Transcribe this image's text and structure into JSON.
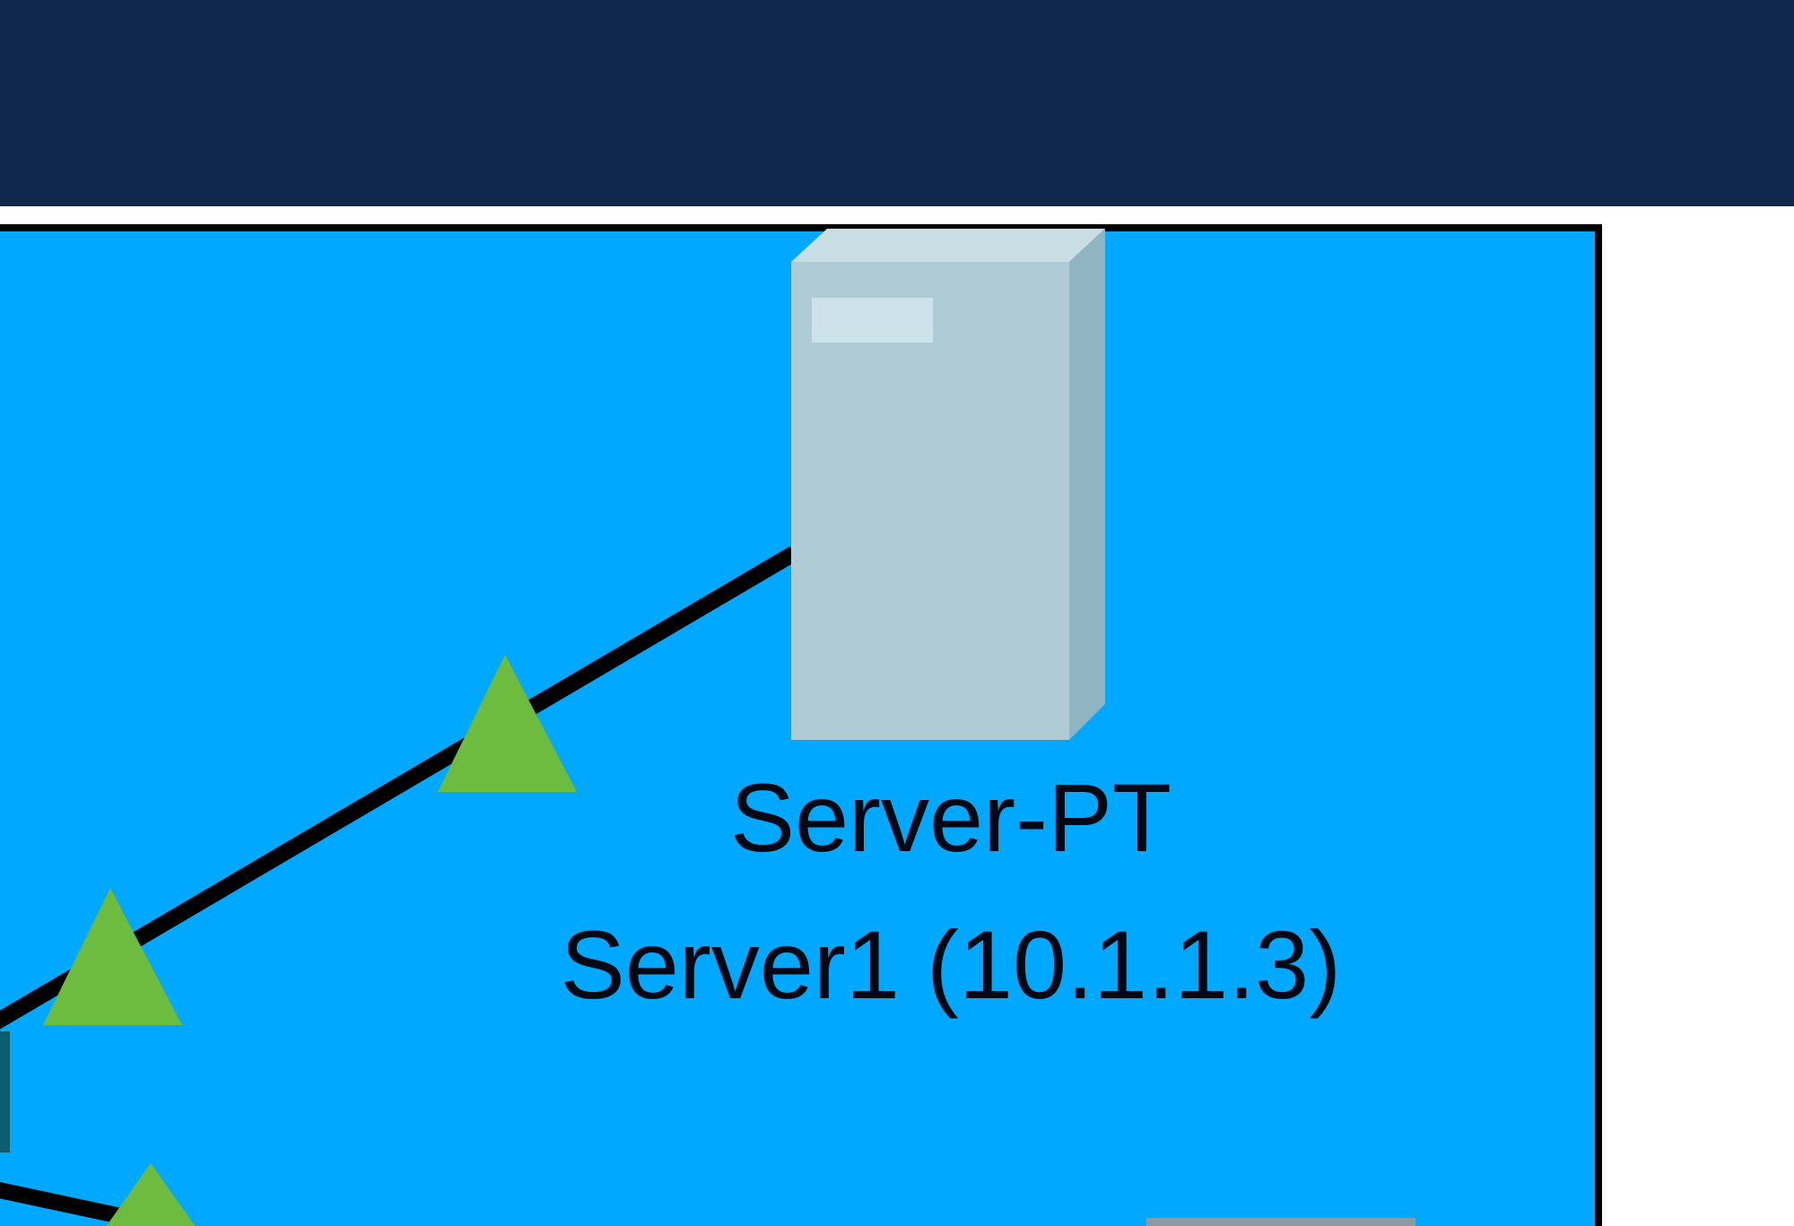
{
  "colors": {
    "topbar": "#10264b",
    "workspace": "#00a8ff",
    "workspace_border": "#000000",
    "link": "#000000",
    "link_status_up": "#6dbb3f",
    "server_front": "#afcbd6",
    "server_side": "#8fb5c3",
    "server_top": "#c9dde5"
  },
  "server": {
    "model": "Server-PT",
    "hostname": "Server1 (10.1.1.3)",
    "icon": "server-icon"
  },
  "link_indicators": [
    {
      "status": "up",
      "icon": "triangle-up-icon"
    },
    {
      "status": "up",
      "icon": "triangle-up-icon"
    },
    {
      "status": "up",
      "icon": "triangle-up-icon"
    }
  ]
}
